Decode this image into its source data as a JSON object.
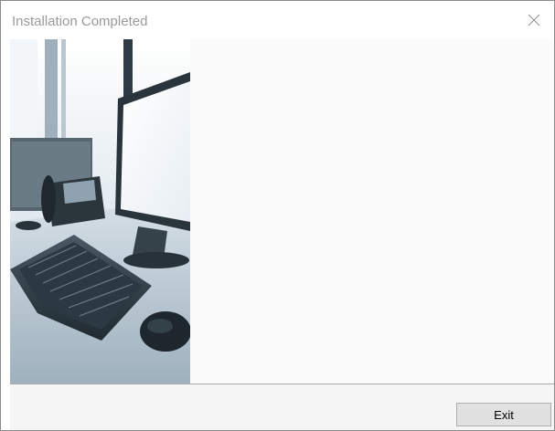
{
  "window": {
    "title": "Installation Completed",
    "close_icon": "close-icon"
  },
  "sidebar": {
    "image_icon": "office-desk-keyboard-phone-monitor-image"
  },
  "footer": {
    "exit_label": "Exit"
  },
  "colors": {
    "title_text": "#9a9a9a",
    "content_bg": "#fbfbfb",
    "footer_bg": "#f5f5f5",
    "button_bg": "#e1e1e1",
    "button_border": "#adadad"
  }
}
